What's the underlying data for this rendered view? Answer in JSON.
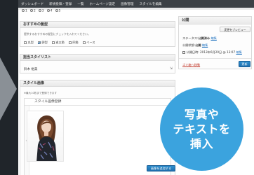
{
  "admin_bar": {
    "items": [
      "ダッシュボード",
      "新規投稿・登録",
      "一覧",
      "ホームページ設定",
      "画像管理",
      "スタイルを編集"
    ]
  },
  "number_row": [
    "1",
    "2",
    "3",
    "4",
    "5"
  ],
  "recommend_box": {
    "title": "おすすめの髪型",
    "description": "提供するおすすめの髪型にチェックを入れてください。",
    "options": [
      {
        "label": "丸型",
        "checked": false
      },
      {
        "label": "卵型",
        "checked": true
      },
      {
        "label": "逆三角",
        "checked": false
      },
      {
        "label": "四角",
        "checked": false
      },
      {
        "label": "ベース",
        "checked": false
      }
    ]
  },
  "stylist_box": {
    "title": "担当スタイリスト",
    "value": "鈴木 裕美"
  },
  "style_image_box": {
    "title": "スタイル画像",
    "description": "※最大10枚まで登録できます",
    "inner_title": "スタイル画像登録",
    "gutter_arrow": "‹",
    "add_button": "画像を追加する"
  },
  "publish_box": {
    "title": "公開",
    "preview_button": "変更をプレビュー",
    "status_label": "ステータス:",
    "status_value": "公開済み",
    "status_edit": "編集",
    "visibility_label": "公開状態:",
    "visibility_value": "公開",
    "visibility_edit": "編集",
    "date_text": "公開日時: 2013年6月20日 @ 13:07",
    "date_edit": "編集",
    "trash_link": "ゴミ箱へ移動",
    "update_button": "更新"
  },
  "promo": {
    "lines": [
      "写真や",
      "テキストを",
      "挿入"
    ],
    "color": "#3ba3de"
  }
}
